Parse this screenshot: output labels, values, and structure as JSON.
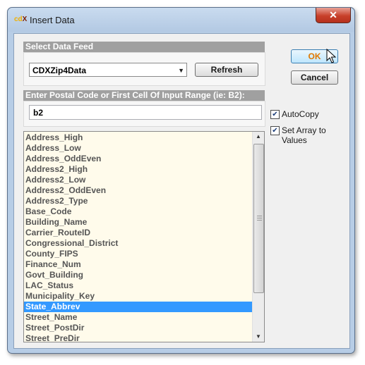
{
  "window": {
    "title": "Insert Data",
    "close_glyph": "✕"
  },
  "feed_group": {
    "header": "Select Data Feed",
    "selected": "CDXZip4Data",
    "refresh_label": "Refresh"
  },
  "dialog_buttons": {
    "ok_label": "OK",
    "cancel_label": "Cancel"
  },
  "postal_group": {
    "header": "Enter Postal Code or First Cell Of Input Range (ie: B2):",
    "value": "b2"
  },
  "options": {
    "autocopy": {
      "label": "AutoCopy",
      "checked": true
    },
    "array_values": {
      "label": "Set Array to Values",
      "checked": true
    }
  },
  "fields": {
    "items": [
      "Address_High",
      "Address_Low",
      "Address_OddEven",
      "Address2_High",
      "Address2_Low",
      "Address2_OddEven",
      "Address2_Type",
      "Base_Code",
      "Building_Name",
      "Carrier_RouteID",
      "Congressional_District",
      "County_FIPS",
      "Finance_Num",
      "Govt_Building",
      "LAC_Status",
      "Municipality_Key",
      "State_Abbrev",
      "Street_Name",
      "Street_PostDir",
      "Street_PreDir"
    ],
    "selected": "State_Abbrev"
  }
}
